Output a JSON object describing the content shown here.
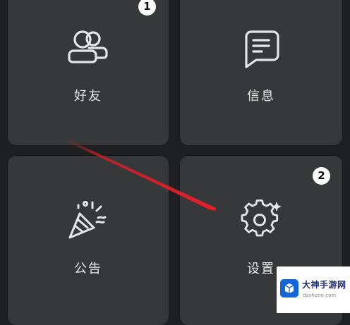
{
  "tiles": {
    "friends": {
      "label": "好友",
      "icon": "friends-icon",
      "badge": "1"
    },
    "messages": {
      "label": "信息",
      "icon": "message-icon"
    },
    "announcements": {
      "label": "公告",
      "icon": "party-popper-icon"
    },
    "settings": {
      "label": "设置",
      "icon": "gear-icon",
      "badge": "2"
    }
  },
  "watermark": {
    "title": "大神手游网",
    "subtitle": "dashenn.com",
    "icon": "cube-logo-icon"
  },
  "colors": {
    "background": "#1f2021",
    "tile": "#373839",
    "icon_stroke": "#e6e6e6",
    "arrow": "#d31f2a",
    "badge": "#ffffff"
  }
}
